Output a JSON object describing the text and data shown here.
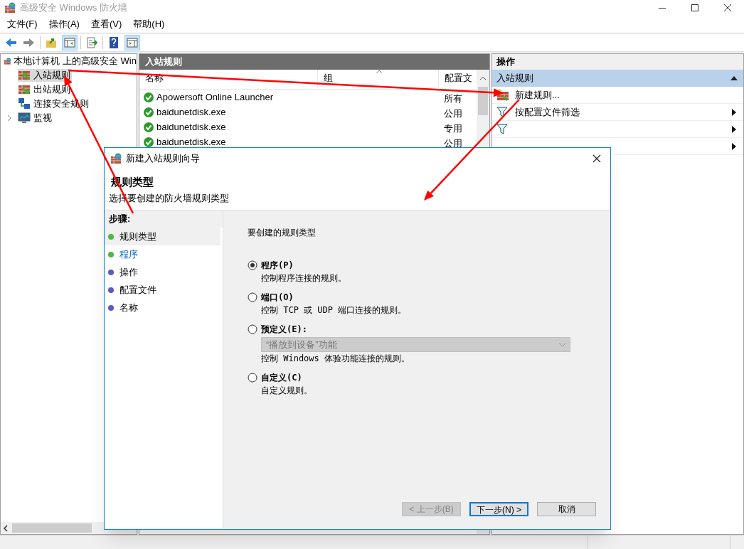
{
  "window": {
    "title": "高级安全 Windows 防火墙"
  },
  "menu": [
    "文件(F)",
    "操作(A)",
    "查看(V)",
    "帮助(H)"
  ],
  "tree": {
    "label": "本地计算机 上的高级安全 Win",
    "children": [
      {
        "label": "入站规则",
        "selected": true,
        "kind": "inbound"
      },
      {
        "label": "出站规则",
        "selected": false,
        "kind": "outbound"
      },
      {
        "label": "连接安全规则",
        "selected": false,
        "kind": "connection"
      },
      {
        "label": "监视",
        "selected": false,
        "kind": "monitor",
        "expandable": true
      }
    ]
  },
  "rules": {
    "title": "入站规则",
    "columns": [
      "名称",
      "组",
      "配置文"
    ],
    "rows": [
      {
        "name": "Apowersoft Online Launcher",
        "profile": "所有"
      },
      {
        "name": "baidunetdisk.exe",
        "profile": "公用"
      },
      {
        "name": "baidunetdisk.exe",
        "profile": "专用"
      },
      {
        "name": "baidunetdisk.exe",
        "profile": "公用"
      }
    ]
  },
  "actions": {
    "title": "操作",
    "section": "入站规则",
    "items": [
      {
        "kind": "new",
        "label": "新建规则...",
        "submenu": false
      },
      {
        "kind": "filter",
        "label": "按配置文件筛选",
        "submenu": true
      },
      {
        "kind": "filter",
        "submenu": true
      },
      {
        "kind": "blank",
        "submenu": true
      }
    ]
  },
  "dialog": {
    "title": "新建入站规则向导",
    "heading": "规则类型",
    "subtitle": "选择要创建的防火墙规则类型",
    "steps_title": "步骤:",
    "steps": [
      {
        "label": "规则类型",
        "selected": true,
        "done": true,
        "link": false
      },
      {
        "label": "程序",
        "selected": false,
        "done": true,
        "link": true
      },
      {
        "label": "操作",
        "selected": false,
        "done": false,
        "link": false
      },
      {
        "label": "配置文件",
        "selected": false,
        "done": false,
        "link": false
      },
      {
        "label": "名称",
        "selected": false,
        "done": false,
        "link": false
      }
    ],
    "prompt": "要创建的规则类型",
    "options": [
      {
        "label": "程序(P)",
        "description": "控制程序连接的规则。",
        "selected": true
      },
      {
        "label": "端口(O)",
        "description": "控制 TCP 或 UDP 端口连接的规则。",
        "selected": false
      },
      {
        "label": "预定义(E):",
        "dropdown": "“播放到设备”功能",
        "description": "控制 Windows 体验功能连接的规则。",
        "selected": false
      },
      {
        "label": "自定义(C)",
        "description": "自定义规则。",
        "selected": false
      }
    ],
    "buttons": [
      {
        "label": "< 上一步(B)",
        "disabled": true,
        "default": false
      },
      {
        "label": "下一步(N) >",
        "disabled": false,
        "default": true
      },
      {
        "label": "取消",
        "disabled": false,
        "default": false
      }
    ]
  }
}
